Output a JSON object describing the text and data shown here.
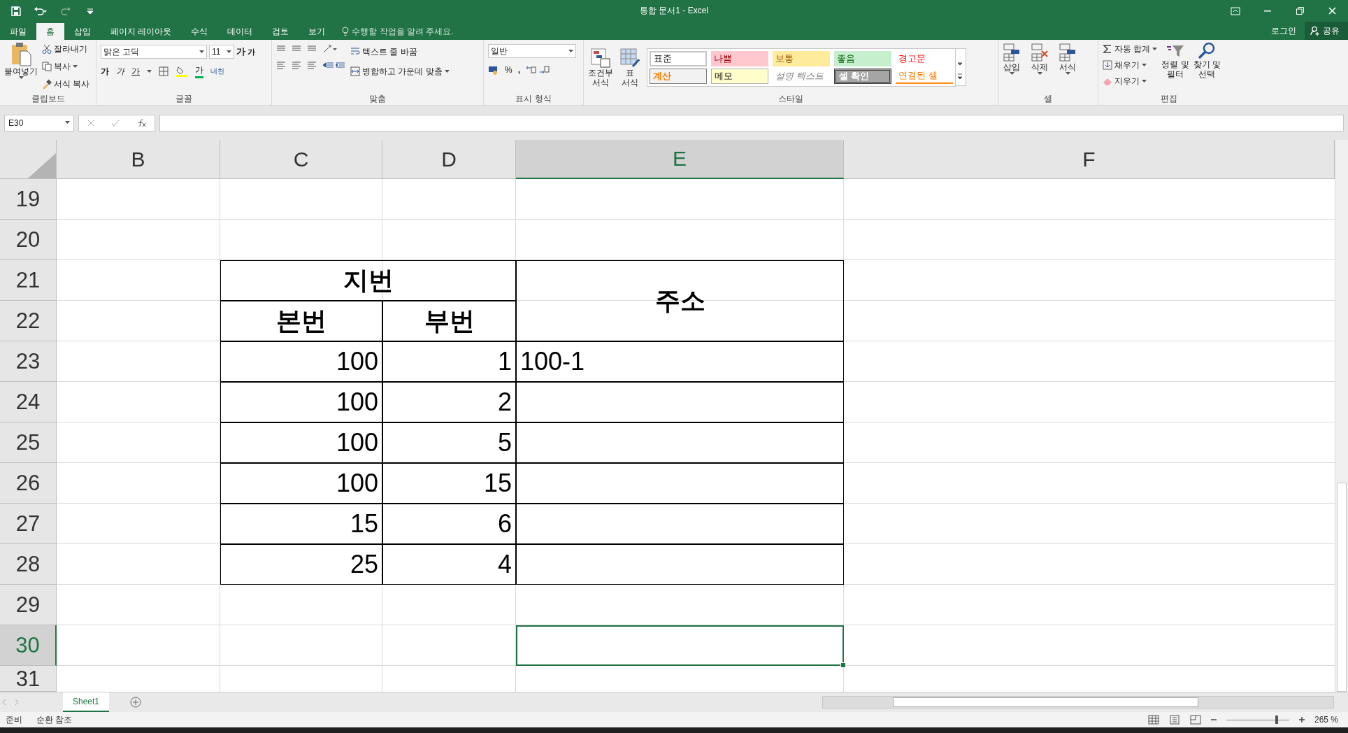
{
  "window": {
    "title": "통합 문서1 - Excel"
  },
  "ribbon_tabs": [
    {
      "label": "파일",
      "selected": false
    },
    {
      "label": "홈",
      "selected": true
    },
    {
      "label": "삽입",
      "selected": false
    },
    {
      "label": "페이지 레이아웃",
      "selected": false
    },
    {
      "label": "수식",
      "selected": false
    },
    {
      "label": "데이터",
      "selected": false
    },
    {
      "label": "검토",
      "selected": false
    },
    {
      "label": "보기",
      "selected": false
    }
  ],
  "tell_me": "수행할 작업을 알려 주세요.",
  "account": {
    "login": "로그인",
    "share": "공유"
  },
  "clipboard": {
    "paste": "붙여넣기",
    "cut": "잘라내기",
    "copy": "복사",
    "format_painter": "서식 복사",
    "label": "클립보드"
  },
  "font": {
    "name": "맑은 고딕",
    "size": "11",
    "grow": "가",
    "shrink": "가",
    "bold": "가",
    "italic": "가",
    "underline": "가",
    "font_color": "가",
    "phonetic": "내천",
    "label": "글꼴"
  },
  "alignment": {
    "wrap": "텍스트 줄 바꿈",
    "merge": "병합하고 가운데 맞춤",
    "label": "맞춤"
  },
  "number": {
    "format": "일반",
    "percent": "%",
    "comma": ",",
    "label": "표시 형식"
  },
  "styles": {
    "conditional": [
      "조건부",
      "서식"
    ],
    "table": [
      "표",
      "서식"
    ],
    "label": "스타일",
    "gallery": [
      {
        "label": "표준",
        "kind": "normal"
      },
      {
        "label": "나쁨",
        "kind": "bad"
      },
      {
        "label": "보통",
        "kind": "neutral"
      },
      {
        "label": "좋음",
        "kind": "good"
      },
      {
        "label": "경고문",
        "kind": "warning"
      },
      {
        "label": "계산",
        "kind": "calculation"
      },
      {
        "label": "메모",
        "kind": "note"
      },
      {
        "label": "설명 텍스트",
        "kind": "explanatory"
      },
      {
        "label": "셀 확인",
        "kind": "check"
      },
      {
        "label": "연결된 셀",
        "kind": "linked"
      }
    ]
  },
  "cells_group": {
    "insert": "삽입",
    "delete": "삭제",
    "format": "서식",
    "label": "셀"
  },
  "editing": {
    "autosum": "자동 합계",
    "fill": "채우기",
    "clear": "지우기",
    "sort": [
      "정렬 및",
      "필터"
    ],
    "find": [
      "찾기 및",
      "선택"
    ],
    "label": "편집"
  },
  "name_box": "E30",
  "columns": [
    {
      "label": "B",
      "selected": false
    },
    {
      "label": "C",
      "selected": false
    },
    {
      "label": "D",
      "selected": false
    },
    {
      "label": "E",
      "selected": true
    },
    {
      "label": "F",
      "selected": false
    }
  ],
  "rows": [
    {
      "label": "19",
      "selected": false
    },
    {
      "label": "20",
      "selected": false
    },
    {
      "label": "21",
      "selected": false
    },
    {
      "label": "22",
      "selected": false
    },
    {
      "label": "23",
      "selected": false
    },
    {
      "label": "24",
      "selected": false
    },
    {
      "label": "25",
      "selected": false
    },
    {
      "label": "26",
      "selected": false
    },
    {
      "label": "27",
      "selected": false
    },
    {
      "label": "28",
      "selected": false
    },
    {
      "label": "29",
      "selected": false
    },
    {
      "label": "30",
      "selected": true
    },
    {
      "label": "31",
      "selected": false
    }
  ],
  "table": {
    "group_header": "지번",
    "address_header": "주소",
    "main_header": "본번",
    "sub_header": "부번",
    "rows": [
      {
        "main": "100",
        "sub": "1",
        "address": "100-1"
      },
      {
        "main": "100",
        "sub": "2"
      },
      {
        "main": "100",
        "sub": "5"
      },
      {
        "main": "100",
        "sub": "15"
      },
      {
        "main": "15",
        "sub": "6"
      },
      {
        "main": "25",
        "sub": "4"
      }
    ]
  },
  "sheet_tabs": [
    {
      "label": "Sheet1",
      "selected": true
    }
  ],
  "status": {
    "ready": "준비",
    "circular": "순환 참조",
    "zoom": "265 %",
    "zoom_slider": {
      "level": 0.82
    }
  }
}
